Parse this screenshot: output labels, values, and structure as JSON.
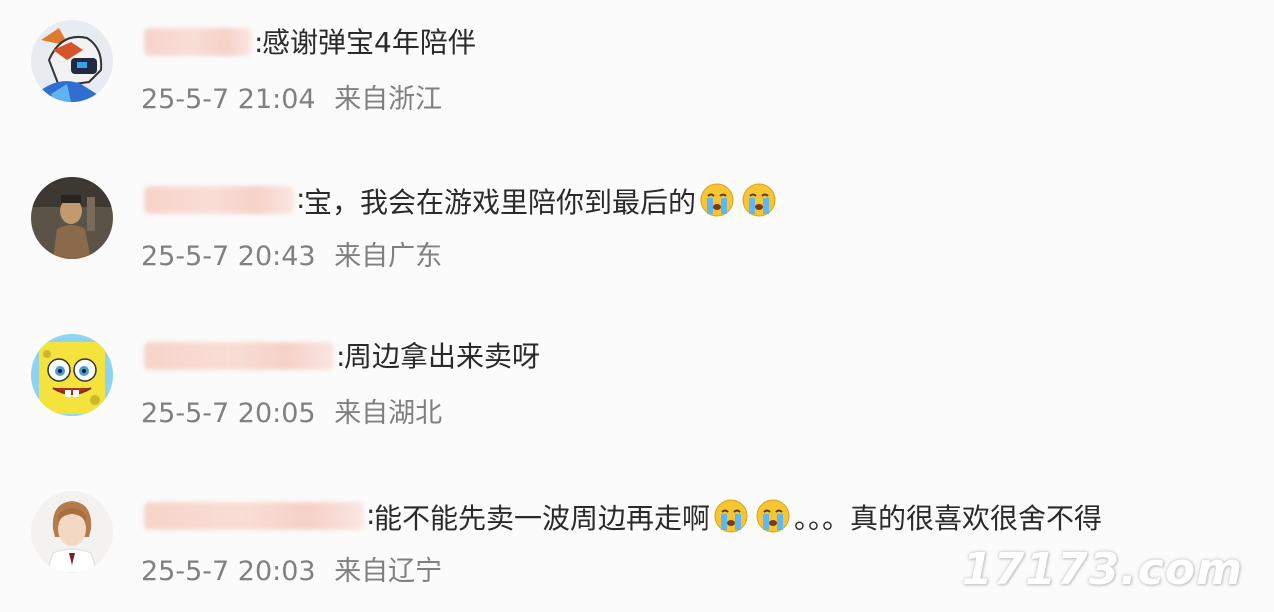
{
  "comments": [
    {
      "colon": ":",
      "text": "感谢弹宝4年陪伴",
      "time": "25-5-7 21:04",
      "location": "来自浙江",
      "avatar": "robot-fox-avatar"
    },
    {
      "colon": ":",
      "text": "宝，我会在游戏里陪你到最后的",
      "emojis": [
        "crying-face-icon",
        "crying-face-icon"
      ],
      "time": "25-5-7 20:43",
      "location": "来自广东",
      "avatar": "dark-figure-avatar"
    },
    {
      "colon": ":",
      "text": "周边拿出来卖呀",
      "time": "25-5-7 20:05",
      "location": "来自湖北",
      "avatar": "spongebob-avatar"
    },
    {
      "colon": ":",
      "text_before": "能不能先卖一波周边再走啊",
      "emojis": [
        "crying-face-icon",
        "crying-face-icon"
      ],
      "text_after": "。。。真的很喜欢很舍不得",
      "time": "25-5-7 20:03",
      "location": "来自辽宁",
      "avatar": "person-avatar"
    }
  ],
  "watermark": "17173.com",
  "colors": {
    "background": "#fbfbfb",
    "text": "#2a2a2a",
    "meta": "#808080",
    "name_blur": "#f7d2c8"
  }
}
